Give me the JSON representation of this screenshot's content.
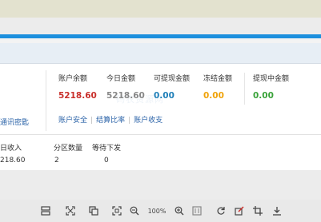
{
  "left_panel": {
    "link": "通讯密匙"
  },
  "account": {
    "columns": [
      {
        "label": "账户余额",
        "value": "5218.60",
        "color": "#c9302c"
      },
      {
        "label": "今日金额",
        "value": "5218.60",
        "color": "#888888"
      },
      {
        "label": "可提现金额",
        "value": "0.00",
        "color": "#1f7fb8"
      },
      {
        "label": "冻结金额",
        "value": "0.00",
        "color": "#f0a30a"
      },
      {
        "label": "提现中金额",
        "value": "0.00",
        "color": "#3aa33a"
      }
    ],
    "links": [
      "账户安全",
      "结算比率",
      "账户收支"
    ]
  },
  "stats": {
    "headers": [
      "日收入",
      "分区数量",
      "等待下发"
    ],
    "values": [
      "218.60",
      "2",
      "0"
    ]
  },
  "toolbar": {
    "zoom": "100%",
    "icons": [
      "layout-icon",
      "fit-width-icon",
      "copy-icon",
      "fit-page-icon",
      "zoom-out-icon",
      "zoom-in-icon",
      "page-icon",
      "rotate-icon",
      "edit-icon",
      "crop-icon",
      "download-icon"
    ]
  }
}
